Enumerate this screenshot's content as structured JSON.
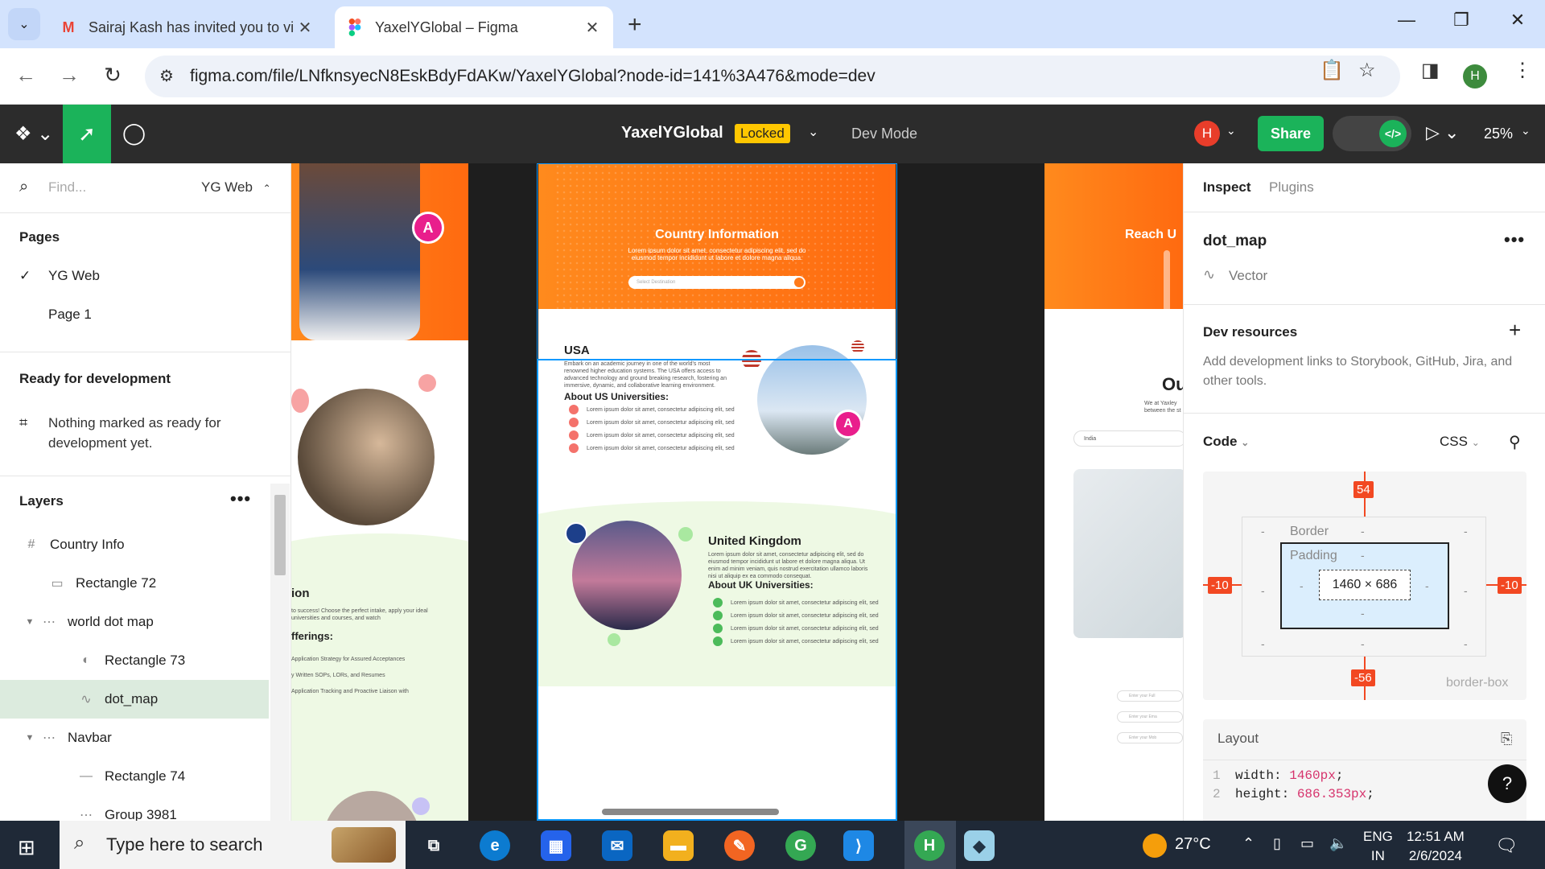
{
  "browser": {
    "tabs": [
      {
        "title": "Sairaj Kash has invited you to vi",
        "icon": "gmail-icon"
      },
      {
        "title": "YaxelYGlobal – Figma",
        "icon": "figma-icon"
      }
    ],
    "url": "figma.com/file/LNfknsyecN8EskBdyFdAKw/YaxelYGlobal?node-id=141%3A476&mode=dev",
    "profile_initial": "H"
  },
  "toolbar": {
    "file_name": "YaxelYGlobal",
    "locked_label": "Locked",
    "mode_label": "Dev Mode",
    "user_initial": "H",
    "share_label": "Share",
    "zoom": "25%"
  },
  "left_panel": {
    "find_placeholder": "Find...",
    "current_page": "YG Web",
    "pages_title": "Pages",
    "pages": [
      "YG Web",
      "Page 1"
    ],
    "ready_title": "Ready for development",
    "ready_message": "Nothing marked as ready for development yet.",
    "layers_title": "Layers",
    "layers": [
      {
        "name": "Country Info",
        "icon": "frame-icon"
      },
      {
        "name": "Rectangle 72",
        "icon": "rectangle-icon"
      },
      {
        "name": "world dot map",
        "icon": "group-icon"
      },
      {
        "name": "Rectangle 73",
        "icon": "mask-icon"
      },
      {
        "name": "dot_map",
        "icon": "vector-icon",
        "selected": true
      },
      {
        "name": "Navbar",
        "icon": "group-icon"
      },
      {
        "name": "Rectangle 74",
        "icon": "line-icon"
      },
      {
        "name": "Group 3981",
        "icon": "group-icon"
      }
    ]
  },
  "canvas": {
    "hero_title": "Country Information",
    "hero_text": "Lorem ipsum dolor sit amet, consectetur adipiscing elit, sed do eiusmod tempor incididunt ut labore et dolore magna aliqua.",
    "select_placeholder": "Select Destination",
    "usa": {
      "title": "USA",
      "desc": "Embark on an academic journey in one of the world's most renowned higher education systems. The USA offers access to advanced technology and ground breaking research, fostering an immersive, dynamic, and collaborative learning environment.",
      "sub": "About US Universities:",
      "items": [
        "Lorem ipsum dolor sit amet, consectetur adipiscing elit, sed",
        "Lorem ipsum dolor sit amet, consectetur adipiscing elit, sed",
        "Lorem ipsum dolor sit amet, consectetur adipiscing elit, sed",
        "Lorem ipsum dolor sit amet, consectetur adipiscing elit, sed"
      ]
    },
    "uk": {
      "title": "United Kingdom",
      "desc": "Lorem ipsum dolor sit amet, consectetur adipiscing elit, sed do eiusmod tempor incididunt ut labore et dolore magna aliqua. Ut enim ad minim veniam, quis nostrud exercitation ullamco laboris nisi ut aliquip ex ea commodo consequat.",
      "sub": "About UK Universities:",
      "items": [
        "Lorem ipsum dolor sit amet, consectetur adipiscing elit, sed",
        "Lorem ipsum dolor sit amet, consectetur adipiscing elit, sed",
        "Lorem ipsum dolor sit amet, consectetur adipiscing elit, sed",
        "Lorem ipsum dolor sit amet, consectetur adipiscing elit, sed"
      ]
    },
    "left_frame": {
      "text_fragment_1": "ion",
      "text_fragment_2": "to success! Choose the perfect intake, apply your ideal universities and courses, and watch",
      "text_fragment_3": "fferings:",
      "items": [
        "Application Strategy for Assured Acceptances",
        "y Written SOPs, LORs, and Resumes",
        "Application Tracking and Proactive Liaison with"
      ]
    },
    "right_frame": {
      "heading": "Reach U",
      "heading2": "Ou",
      "sub": "We at Yaxley between the st",
      "field": "India",
      "form_fields": [
        "Enter your Full",
        "Enter your Ema",
        "Enter your Mob"
      ]
    },
    "badge_letter": "A"
  },
  "right_panel": {
    "tabs": [
      "Inspect",
      "Plugins"
    ],
    "selection_name": "dot_map",
    "selection_type": "Vector",
    "dev_resources_title": "Dev resources",
    "dev_resources_desc": "Add development links to Storybook, GitHub, Jira, and other tools.",
    "code_title": "Code",
    "code_lang": "CSS",
    "box": {
      "top": "54",
      "bottom": "-56",
      "left": "-10",
      "right": "-10",
      "border_label": "Border",
      "padding_label": "Padding",
      "size": "1460 × 686",
      "dash": "-",
      "sizing": "border-box"
    },
    "layout_title": "Layout",
    "code_lines": [
      {
        "n": "1",
        "prop": "width:",
        "val": "1460px",
        "end": ";"
      },
      {
        "n": "2",
        "prop": "height:",
        "val": "686.353px",
        "end": ";"
      }
    ],
    "help": "?"
  },
  "taskbar": {
    "search_placeholder": "Type here to search",
    "temp": "27°C",
    "lang1": "ENG",
    "lang2": "IN",
    "time": "12:51 AM",
    "date": "2/6/2024"
  },
  "colors": {
    "figma_green": "#1bb35a",
    "orange": "#ff7a1a",
    "selection_red": "#f24822",
    "selection_blue": "#0d99ff"
  }
}
